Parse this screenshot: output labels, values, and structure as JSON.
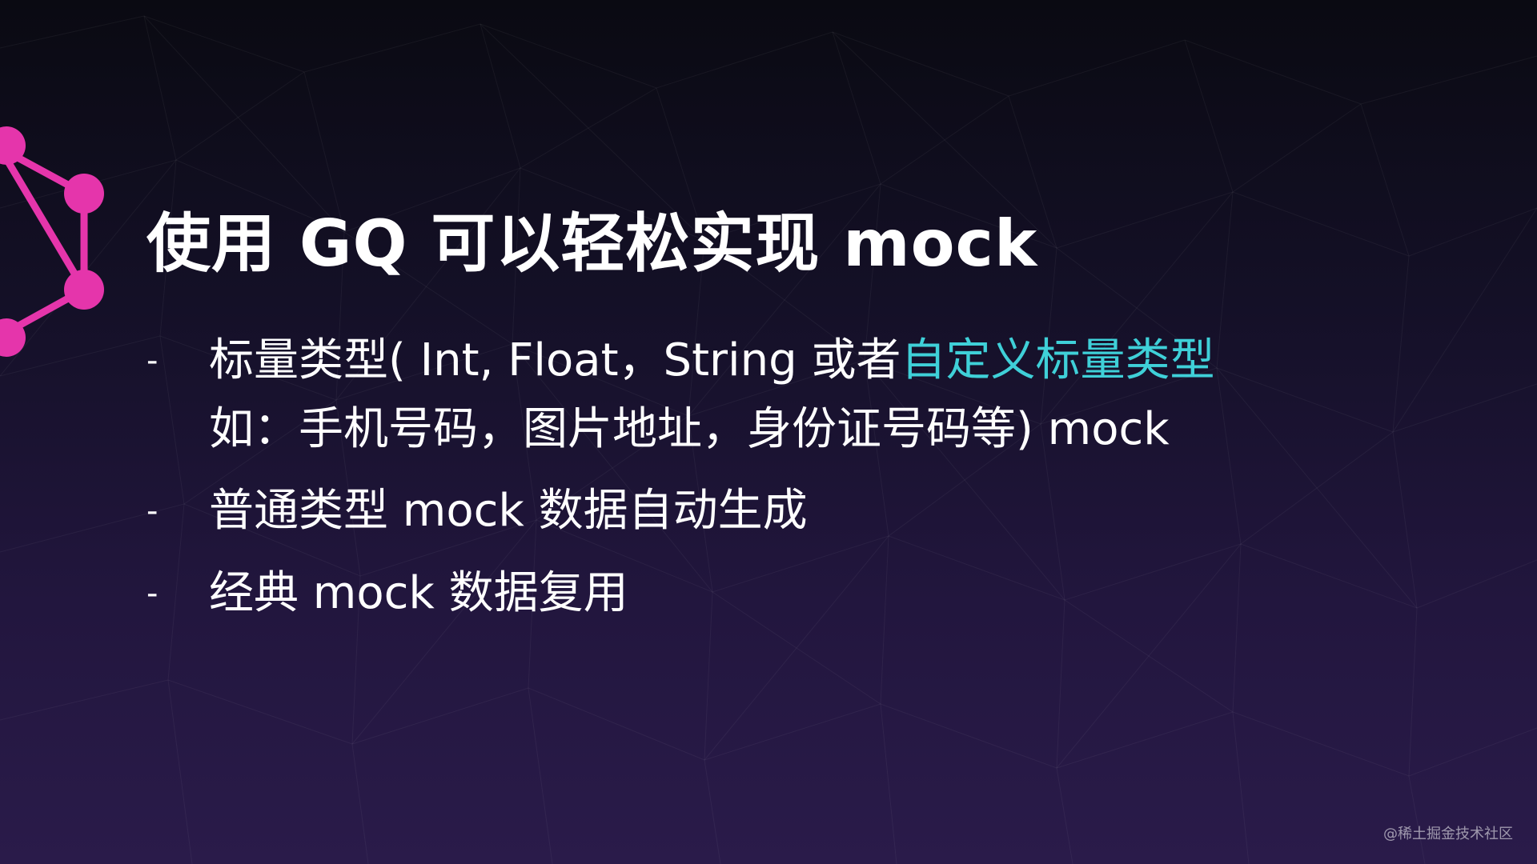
{
  "slide": {
    "title": "使用 GQ 可以轻松实现 mock",
    "bullet_marker": "-",
    "bullets": [
      {
        "line1_prefix": "标量类型( Int, Float，String 或者",
        "line1_highlight": "自定义标量类型",
        "line2": "如：手机号码，图片地址，身份证号码等) mock"
      },
      {
        "text": "普通类型 mock 数据自动生成"
      },
      {
        "text": "经典 mock 数据复用"
      }
    ]
  },
  "watermark": "@稀土掘金技术社区",
  "colors": {
    "highlight": "#3fd0d8",
    "logo": "#e535ab",
    "background_top": "#0a0a12",
    "background_bottom": "#2a1b4a"
  },
  "icons": {
    "logo": "graphql-logo"
  }
}
